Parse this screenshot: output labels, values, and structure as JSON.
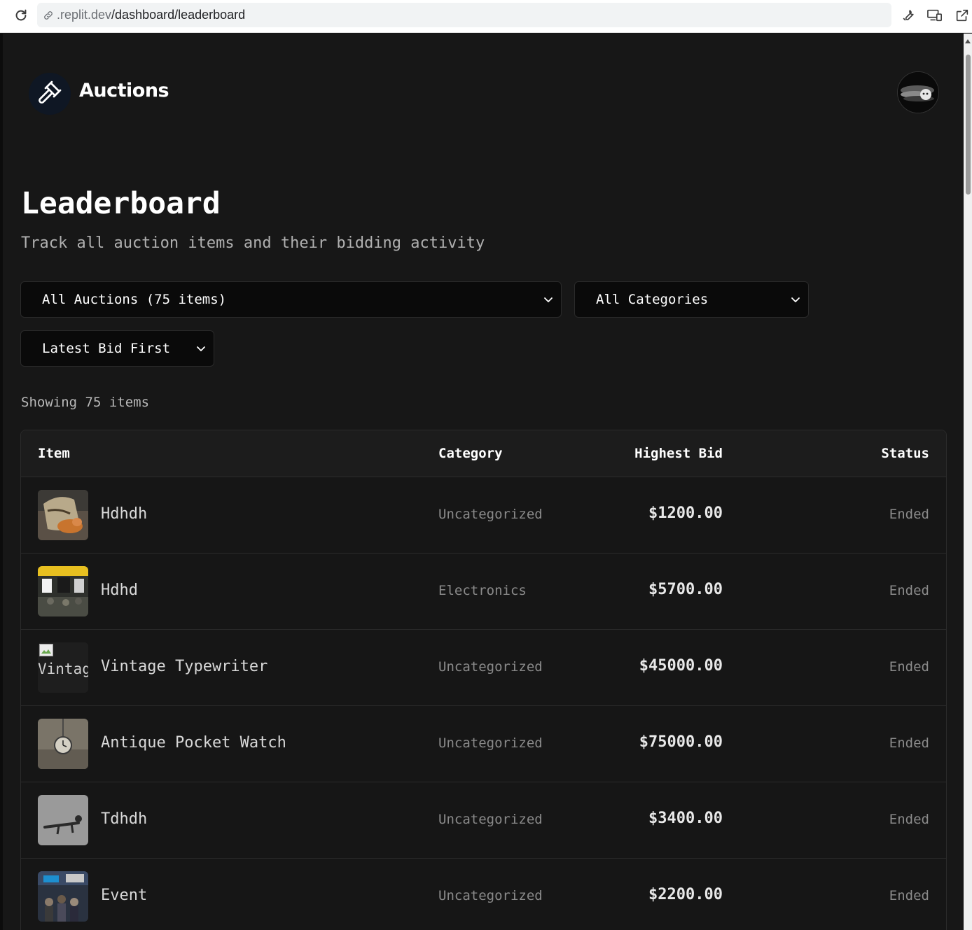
{
  "browser": {
    "url_host": ".replit.dev",
    "url_path": "/dashboard/leaderboard"
  },
  "header": {
    "brand": "Auctions",
    "logo_icon": "gavel-icon"
  },
  "page": {
    "title": "Leaderboard",
    "subtitle": "Track all auction items and their bidding activity"
  },
  "filters": {
    "auction_filter": "All Auctions (75 items)",
    "category_filter": "All Categories",
    "sort": "Latest Bid First"
  },
  "summary": {
    "showing": "Showing 75 items"
  },
  "table": {
    "headers": {
      "item": "Item",
      "category": "Category",
      "highest_bid": "Highest Bid",
      "status": "Status"
    },
    "rows": [
      {
        "name": "Hdhdh",
        "category": "Uncategorized",
        "bid": "$1200.00",
        "status": "Ended"
      },
      {
        "name": "Hdhd",
        "category": "Electronics",
        "bid": "$5700.00",
        "status": "Ended"
      },
      {
        "name": "Vintage Typewriter",
        "category": "Uncategorized",
        "bid": "$45000.00",
        "status": "Ended",
        "image_alt": "Vintage"
      },
      {
        "name": "Antique Pocket Watch",
        "category": "Uncategorized",
        "bid": "$75000.00",
        "status": "Ended"
      },
      {
        "name": "Tdhdh",
        "category": "Uncategorized",
        "bid": "$3400.00",
        "status": "Ended"
      },
      {
        "name": "Event",
        "category": "Uncategorized",
        "bid": "$2200.00",
        "status": "Ended"
      }
    ]
  }
}
